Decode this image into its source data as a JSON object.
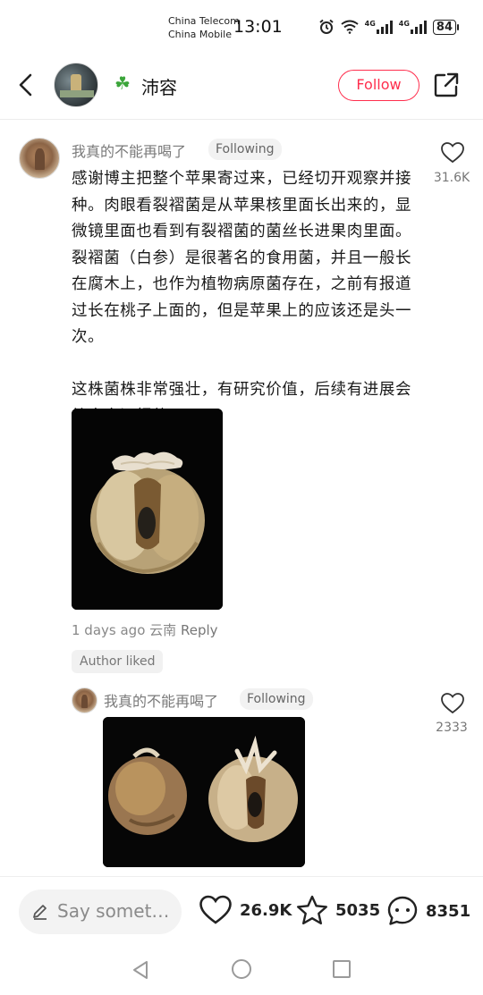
{
  "status_bar": {
    "carrier_1": "China Telecom",
    "carrier_2": "China Mobile",
    "time": "13:01",
    "net_1": "4G",
    "net_2": "4G",
    "battery": "84"
  },
  "header": {
    "emoji_icon": "four-leaf-clover",
    "username": "沛容",
    "follow_label": "Follow"
  },
  "comments": [
    {
      "author": "我真的不能再喝了",
      "badge": "Following",
      "like_count": "31.6K",
      "text": "感谢博主把整个苹果寄过来，已经切开观察并接种。肉眼看裂褶菌是从苹果核里面长出来的，显微镜里面也看到有裂褶菌的菌丝长进果肉里面。裂褶菌（白参）是很著名的食用菌，并且一般长在腐木上，也作为植物病原菌存在，之前有报道过长在桃子上面的，但是苹果上的应该还是头一次。\n\n这株菌株非常强壮，有研究价值，后续有进展会给大家汇报的。",
      "time": "1 days ago",
      "location": "云南",
      "reply_label": "Reply",
      "author_liked": "Author liked"
    },
    {
      "author": "我真的不能再喝了",
      "badge": "Following",
      "like_count": "2333"
    }
  ],
  "bottom_bar": {
    "input_placeholder": "Say somet…",
    "likes": "26.9K",
    "collects": "5035",
    "comments": "8351"
  },
  "colors": {
    "accent": "#ff2e4d",
    "muted_text": "#888888"
  }
}
